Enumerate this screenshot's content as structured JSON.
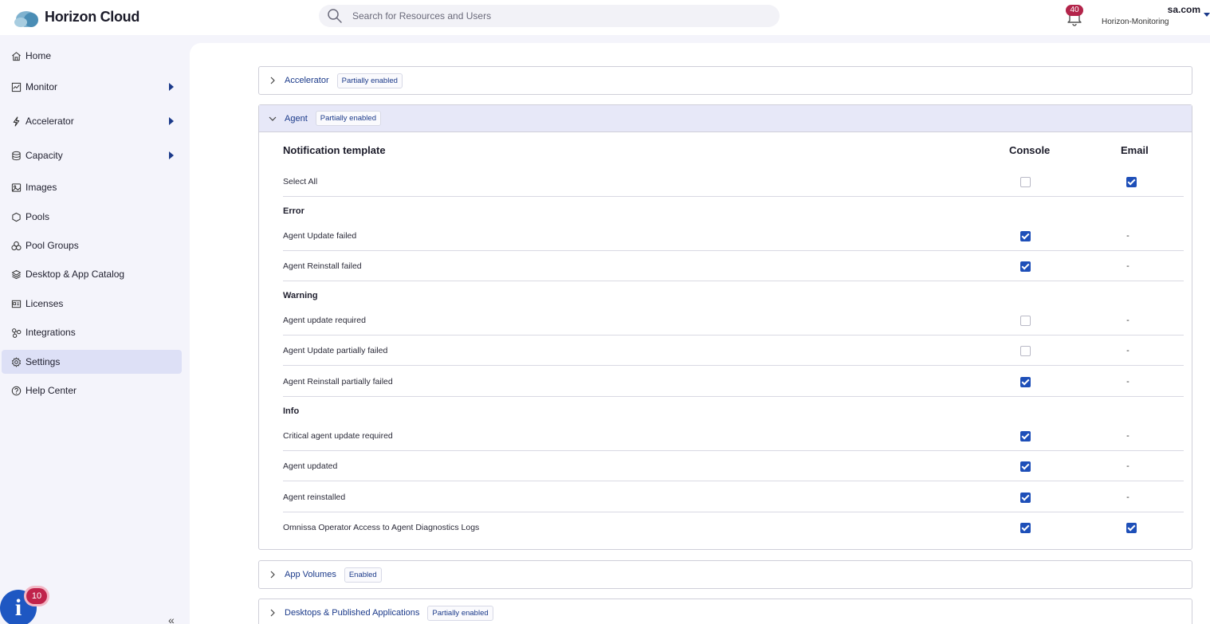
{
  "app": {
    "title": "Horizon Cloud"
  },
  "search": {
    "placeholder": "Search for Resources and Users"
  },
  "notifications": {
    "count": "40"
  },
  "user": {
    "email": "sa.com",
    "org": "Horizon-Monitoring"
  },
  "sidebar": {
    "items": [
      {
        "label": "Home",
        "icon": "home-icon"
      },
      {
        "label": "Monitor",
        "icon": "monitor-icon",
        "expandable": true
      },
      {
        "label": "Accelerator",
        "icon": "bolt-icon",
        "expandable": true
      },
      {
        "label": "Capacity",
        "icon": "database-icon",
        "expandable": true
      },
      {
        "label": "Images",
        "icon": "image-icon"
      },
      {
        "label": "Pools",
        "icon": "hexagon-icon"
      },
      {
        "label": "Pool Groups",
        "icon": "pool-groups-icon"
      },
      {
        "label": "Desktop & App Catalog",
        "icon": "layers-icon"
      },
      {
        "label": "Licenses",
        "icon": "license-icon"
      },
      {
        "label": "Integrations",
        "icon": "integrations-icon"
      },
      {
        "label": "Settings",
        "icon": "gear-icon",
        "active": true
      },
      {
        "label": "Help Center",
        "icon": "help-icon"
      }
    ]
  },
  "info_fab": {
    "glyph": "i",
    "badge": "10"
  },
  "collapse": {
    "glyph": "«"
  },
  "sections": {
    "accelerator": {
      "title": "Accelerator",
      "status": "Partially enabled"
    },
    "agent": {
      "title": "Agent",
      "status": "Partially enabled"
    },
    "app_volumes": {
      "title": "App Volumes",
      "status": "Enabled"
    },
    "desktops": {
      "title": "Desktops & Published Applications",
      "status": "Partially enabled"
    }
  },
  "table": {
    "headers": {
      "template": "Notification template",
      "console": "Console",
      "email": "Email"
    },
    "select_all": {
      "label": "Select All",
      "console": false,
      "email": true
    },
    "groups": {
      "error": "Error",
      "warning": "Warning",
      "info": "Info"
    },
    "rows": [
      {
        "label": "Agent Update failed",
        "console": true,
        "email": "-"
      },
      {
        "label": "Agent Reinstall failed",
        "console": true,
        "email": "-"
      },
      {
        "label": "Agent update required",
        "console": false,
        "email": "-"
      },
      {
        "label": "Agent Update partially failed",
        "console": false,
        "email": "-"
      },
      {
        "label": "Agent Reinstall partially failed",
        "console": true,
        "email": "-"
      },
      {
        "label": "Critical agent update required",
        "console": true,
        "email": "-"
      },
      {
        "label": "Agent updated",
        "console": true,
        "email": "-"
      },
      {
        "label": "Agent reinstalled",
        "console": true,
        "email": "-"
      },
      {
        "label": "Omnissa Operator Access to Agent Diagnostics Logs",
        "console": true,
        "email": true
      }
    ]
  },
  "colors": {
    "accent": "#1e4fb8",
    "active_nav": "#dde0f6",
    "badge": "#b3244a",
    "link": "#1b3a8a"
  }
}
